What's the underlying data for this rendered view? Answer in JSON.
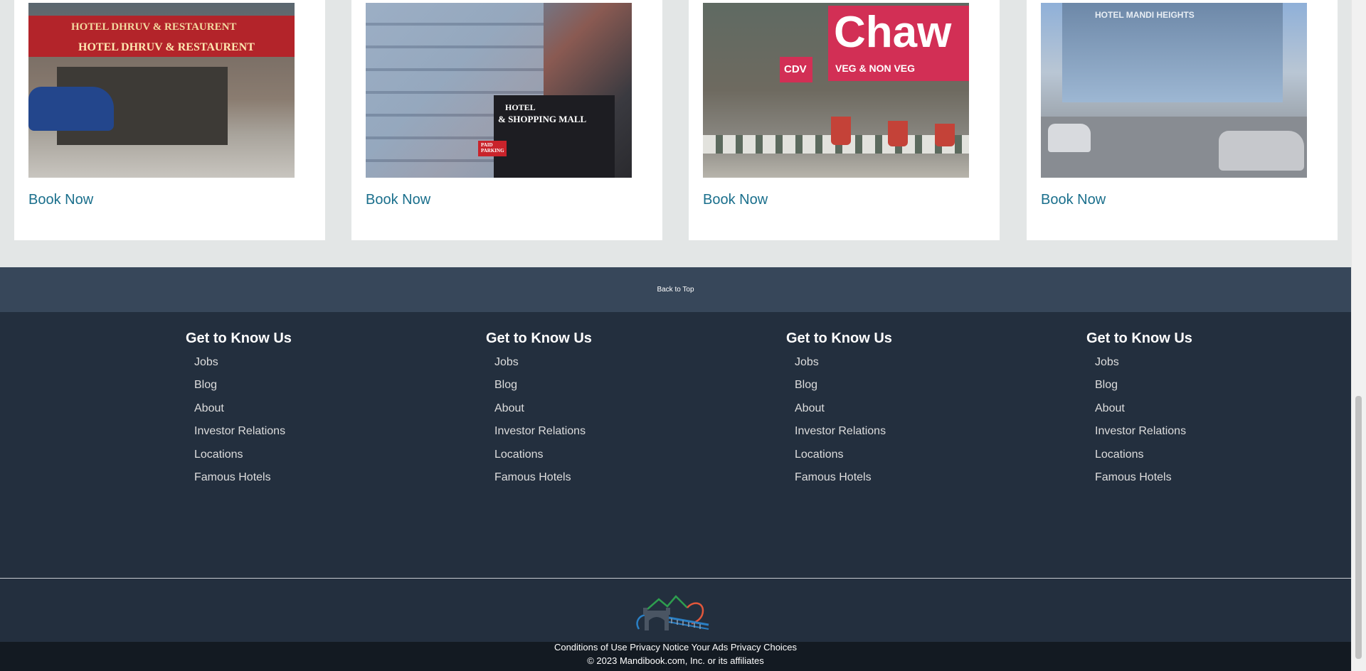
{
  "cards": [
    {
      "book_label": "Book Now",
      "sign_line1": "HOTEL DHRUV & RESTAURENT",
      "sign_line2": "HOTEL DHRUV & RESTAURENT"
    },
    {
      "book_label": "Book Now",
      "sign_line1": "HOTEL",
      "sign_line2": "& SHOPPING MALL",
      "sign_line3": "PAID PARKING"
    },
    {
      "book_label": "Book Now",
      "sign_line1": "Chaw",
      "sign_line2": "CDV",
      "sign_line3": "VEG & NON VEG"
    },
    {
      "book_label": "Book Now",
      "sign_line1": "HOTEL MANDI HEIGHTS"
    }
  ],
  "back_to_top": "Back to Top",
  "footer_columns": [
    {
      "title": "Get to Know Us",
      "links": [
        "Jobs",
        "Blog",
        "About",
        "Investor Relations",
        "Locations",
        "Famous Hotels"
      ]
    },
    {
      "title": "Get to Know Us",
      "links": [
        "Jobs",
        "Blog",
        "About",
        "Investor Relations",
        "Locations",
        "Famous Hotels"
      ]
    },
    {
      "title": "Get to Know Us",
      "links": [
        "Jobs",
        "Blog",
        "About",
        "Investor Relations",
        "Locations",
        "Famous Hotels"
      ]
    },
    {
      "title": "Get to Know Us",
      "links": [
        "Jobs",
        "Blog",
        "About",
        "Investor Relations",
        "Locations",
        "Famous Hotels"
      ]
    }
  ],
  "bottom": {
    "links": [
      "Conditions of Use",
      "Privacy Notice",
      "Your Ads Privacy Choices"
    ],
    "copyright": "© 2023 Mandibook.com, Inc. or its affiliates"
  },
  "colors": {
    "link": "#1a6f8c",
    "footer_bg": "#232f3e",
    "back_to_top_bg": "#37475a",
    "bottom_bg": "#131a22"
  }
}
